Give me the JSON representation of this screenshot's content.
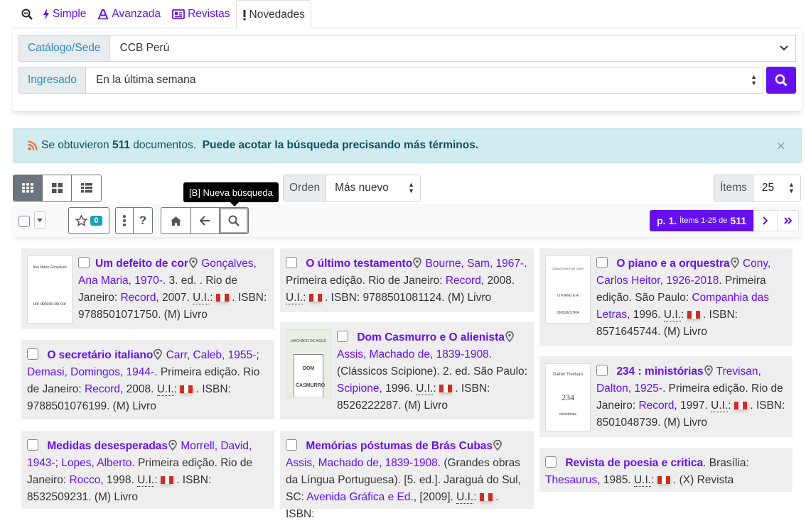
{
  "tabs": [
    {
      "label": ""
    },
    {
      "label": "Simple"
    },
    {
      "label": "Avanzada"
    },
    {
      "label": "Revistas"
    },
    {
      "label": "Novedades"
    }
  ],
  "search": {
    "catalog_label": "Catálogo/Sede",
    "catalog_value": "CCB Perú",
    "ingresado_label": "Ingresado",
    "ingresado_value": "En la última semana"
  },
  "alert": {
    "prefix": "Se obtuvieron",
    "count": "511",
    "suffix": "documentos.",
    "hint": "Puede acotar la búsqueda precisando más términos."
  },
  "sort": {
    "label": "Orden",
    "value": "Más nuevo"
  },
  "items_per_page": {
    "label": "Ítems",
    "value": "25"
  },
  "tooltip": "[B] Nueva búsqueda",
  "toolbar": {
    "favorites_count": "0"
  },
  "pager": {
    "page": "p. 1.",
    "range_prefix": "Ítems 1-25 de",
    "total": "511"
  },
  "colors": {
    "accent": "#6610f2",
    "alert_bg": "#d1ecf1",
    "card_bg": "#eeeeee"
  },
  "records": [
    {
      "title": "Um defeito de cor",
      "author": "Gonçalves, Ana Maria, 1970-",
      "details1": ". 3. ed. . Rio de Janeiro: ",
      "publisher": "Record",
      "details2": ", 2007. ",
      "ui": "U.I.",
      "details3": ": ",
      "isbn": ". ISBN: 9788501071750. (M) Livro",
      "cover_title": "um defeito de cor",
      "cover_author": "Ana Maria Gonçalves"
    },
    {
      "title": "O último testamento",
      "author": "Bourne, Sam, 1967-",
      "details1": ". Primeira edição. Rio de Janeiro: ",
      "publisher": "Record",
      "details2": ", 2008. ",
      "ui": "U.I.",
      "details3": ": ",
      "isbn": ". ISBN: 9788501081124. (M) Livro"
    },
    {
      "title": "O piano e a orquestra",
      "author": "Cony, Carlos Heitor, 1926-2018",
      "details1": ". Primeira edição. São Paulo: ",
      "publisher": "Companhia das Letras",
      "details2": ", 1996. ",
      "ui": "U.I.",
      "details3": ": ",
      "isbn": ". ISBN: 8571645744. (M) Livro",
      "cover_title": "O PIANO E A ORQUESTRA",
      "cover_author": "CARLOS HEITOR CONY"
    },
    {
      "title": "O secretário italiano",
      "author": "Carr, Caleb, 1955-",
      "author2": "Demasi, Domingos, 1944-",
      "details1": ". Primeira edição. Rio de Janeiro: ",
      "publisher": "Record",
      "details2": ", 2008. ",
      "ui": "U.I.",
      "details3": ": ",
      "isbn": ". ISBN: 9788501076199. (M) Livro"
    },
    {
      "title": "Dom Casmurro e O alienista",
      "author": "Assis, Machado de, 1839-1908",
      "details1": ". (Clássicos Scipione). 2. ed. São Paulo: ",
      "publisher": "Scipione",
      "details2": ", 1996. ",
      "ui": "U.I.",
      "details3": ": ",
      "isbn": ". ISBN: 8526222287. (M) Livro",
      "cover_title": "DOM CASMURRO",
      "cover_author": "MACHADO DE ASSIS"
    },
    {
      "title": "234 : ministórias",
      "author": "Trevisan, Dalton, 1925-",
      "details1": ". Primeira edição. Rio de Janeiro: ",
      "publisher": "Record",
      "details2": ", 1997. ",
      "ui": "U.I.",
      "details3": ": ",
      "isbn": ". ISBN: 8501048739. (M) Livro",
      "cover_title": "234",
      "cover_author": "Dalton Trevisan",
      "cover_sub": "ministórias"
    },
    {
      "title": "Medidas desesperadas",
      "author": "Morrell, David, 1943-",
      "author2": "Lopes, Alberto",
      "details1": ". Primeira edição. Rio de Janeiro: ",
      "publisher": "Rocco",
      "details2": ", 1998. ",
      "ui": "U.I.",
      "details3": ": ",
      "isbn": ". ISBN: 8532509231. (M) Livro"
    },
    {
      "title": "Memórias póstumas de Brás Cubas",
      "author": "Assis, Machado de, 1839-1908",
      "details1": ". (Grandes obras da Língua Portuguesa). [5. ed.]. Jaraguá do Sul, SC: ",
      "publisher": "Avenida Gráfica e Ed.",
      "details2": ", [2009]. ",
      "ui": "U.I.",
      "details3": ": ",
      "isbn": ". ISBN:"
    },
    {
      "title": "Revista de poesia e critica",
      "details1": ". Brasília: ",
      "publisher": "Thesaurus",
      "details2": ", 1985. ",
      "ui": "U.I.",
      "details3": ": ",
      "isbn": ". (X) Revista"
    }
  ]
}
